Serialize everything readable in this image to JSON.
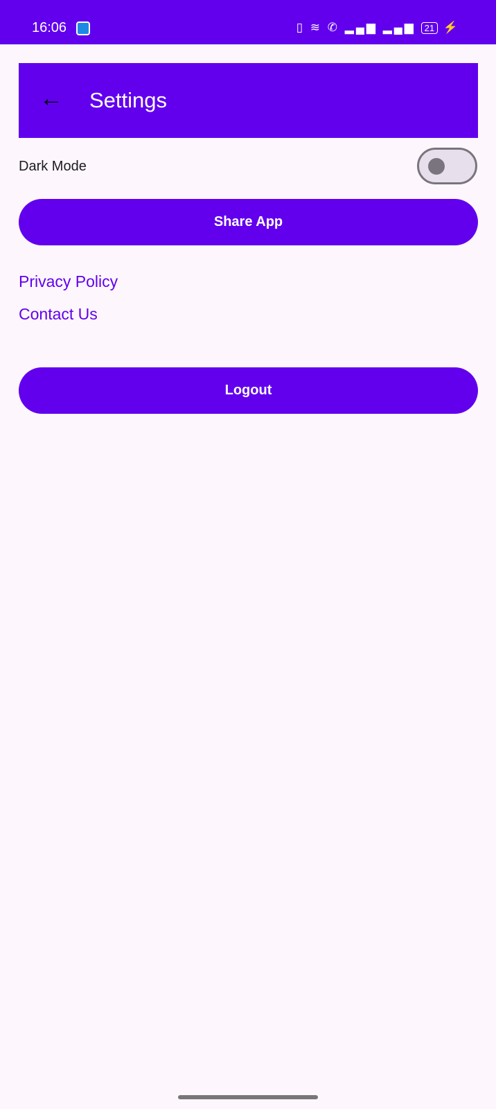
{
  "status_bar": {
    "time": "16:06",
    "battery": "21",
    "icons": [
      "app-notification-icon",
      "vibrate-icon",
      "wifi-icon",
      "volte-call-icon",
      "signal-icon",
      "signal-icon",
      "battery-icon",
      "charging-icon"
    ]
  },
  "toolbar": {
    "title": "Settings",
    "back_icon": "arrow-back-icon"
  },
  "settings": {
    "dark_mode_label": "Dark Mode",
    "dark_mode_on": false,
    "share_label": "Share App",
    "privacy_label": "Privacy Policy",
    "contact_label": "Contact Us",
    "logout_label": "Logout"
  },
  "colors": {
    "primary": "#6200ee",
    "background": "#fdf7fd"
  }
}
